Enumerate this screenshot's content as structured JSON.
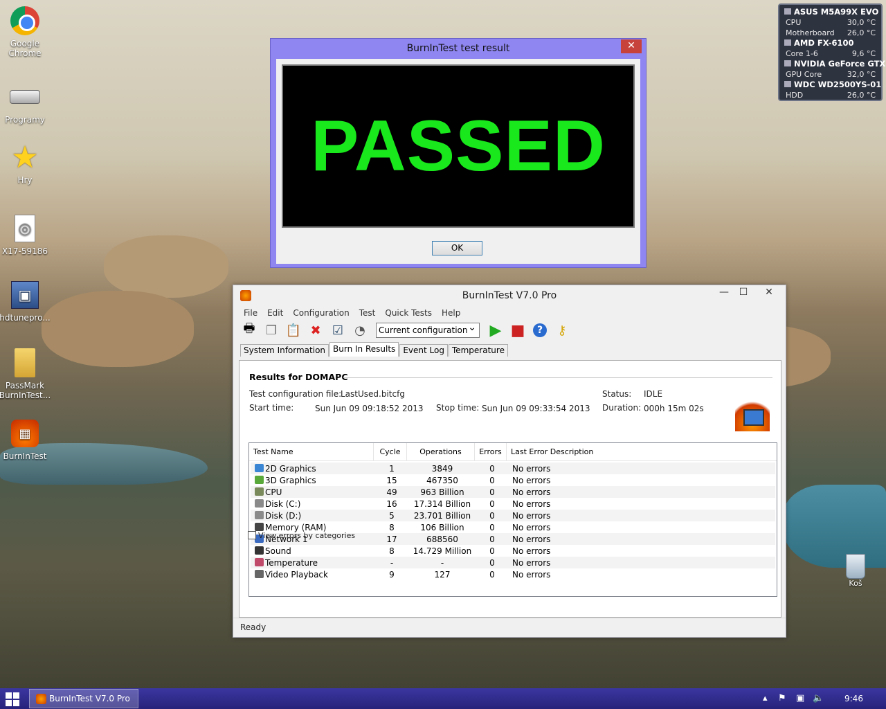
{
  "desktop": {
    "icons": [
      {
        "label": "Google Chrome"
      },
      {
        "label": "Programy"
      },
      {
        "label": "Hry"
      },
      {
        "label": "X17-59186"
      },
      {
        "label": "hdtunepro..."
      },
      {
        "label": "PassMark BurnInTest..."
      },
      {
        "label": "BurnInTest"
      }
    ],
    "recycle_label": "Koš"
  },
  "gadget": {
    "board": "ASUS M5A99X EVO",
    "rows1": [
      {
        "k": "CPU",
        "v": "30,0 °C"
      },
      {
        "k": "Motherboard",
        "v": "26,0 °C"
      }
    ],
    "cpu_name": "AMD FX-6100",
    "rows2": [
      {
        "k": "Core 1-6",
        "v": "9,6 °C"
      }
    ],
    "gpu_name": "NVIDIA GeForce GTX",
    "rows3": [
      {
        "k": "GPU Core",
        "v": "32,0 °C"
      }
    ],
    "hdd_name": "WDC WD2500YS-01",
    "rows4": [
      {
        "k": "HDD",
        "v": "26,0 °C"
      }
    ]
  },
  "dialog": {
    "title": "BurnInTest test result",
    "close": "✕",
    "result": "PASSED",
    "ok": "OK"
  },
  "window": {
    "title": "BurnInTest V7.0 Pro",
    "minimize": "—",
    "maximize": "☐",
    "close": "✕",
    "menu": [
      "File",
      "Edit",
      "Configuration",
      "Test",
      "Quick Tests",
      "Help"
    ],
    "config_select": "Current configuration",
    "tabs": [
      "System Information",
      "Burn In Results",
      "Event Log",
      "Temperature"
    ],
    "results_header": "Results for DOMAPC",
    "config_file_label": "Test configuration file:",
    "config_file": "LastUsed.bitcfg",
    "status_label": "Status:",
    "status": "IDLE",
    "start_label": "Start time:",
    "start": "Sun Jun 09 09:18:52 2013",
    "stop_label": "Stop time:",
    "stop": "Sun Jun 09 09:33:54 2013",
    "duration_label": "Duration:",
    "duration": "000h 15m 02s",
    "columns": [
      "Test Name",
      "Cycle",
      "Operations",
      "Errors",
      "Last Error Description"
    ],
    "rows": [
      {
        "name": "2D Graphics",
        "cycle": "1",
        "ops": "3849",
        "errors": "0",
        "desc": "No errors",
        "color": "#3a86d4"
      },
      {
        "name": "3D Graphics",
        "cycle": "15",
        "ops": "467350",
        "errors": "0",
        "desc": "No errors",
        "color": "#58a83a"
      },
      {
        "name": "CPU",
        "cycle": "49",
        "ops": "963 Billion",
        "errors": "0",
        "desc": "No errors",
        "color": "#7a8a5a"
      },
      {
        "name": "Disk (C:)",
        "cycle": "16",
        "ops": "17.314 Billion",
        "errors": "0",
        "desc": "No errors",
        "color": "#8a8a8a"
      },
      {
        "name": "Disk (D:)",
        "cycle": "5",
        "ops": "23.701 Billion",
        "errors": "0",
        "desc": "No errors",
        "color": "#8a8a8a"
      },
      {
        "name": "Memory (RAM)",
        "cycle": "8",
        "ops": "106 Billion",
        "errors": "0",
        "desc": "No errors",
        "color": "#444444"
      },
      {
        "name": "Network 1",
        "cycle": "17",
        "ops": "688560",
        "errors": "0",
        "desc": "No errors",
        "color": "#3a6ac0"
      },
      {
        "name": "Sound",
        "cycle": "8",
        "ops": "14.729 Million",
        "errors": "0",
        "desc": "No errors",
        "color": "#333333"
      },
      {
        "name": "Temperature",
        "cycle": "-",
        "ops": "-",
        "errors": "0",
        "desc": "No errors",
        "color": "#c04a6a"
      },
      {
        "name": "Video Playback",
        "cycle": "9",
        "ops": "127",
        "errors": "0",
        "desc": "No errors",
        "color": "#666666"
      }
    ],
    "view_by_categories": "View errors by categories",
    "statusbar": "Ready"
  },
  "taskbar": {
    "task_label": "BurnInTest V7.0 Pro",
    "clock": "9:46"
  }
}
